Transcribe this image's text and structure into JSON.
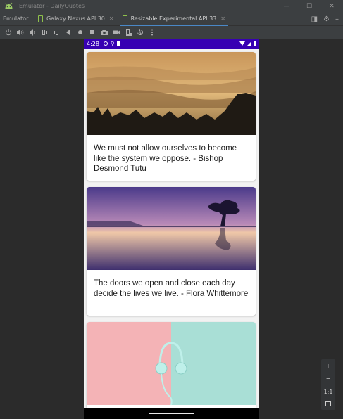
{
  "window": {
    "title": "Emulator - DailyQuotes",
    "minimize_icon": "minimize-icon",
    "maximize_icon": "maximize-icon",
    "close_icon": "close-icon"
  },
  "tabs": {
    "label": "Emulator:",
    "items": [
      {
        "label": "Galaxy Nexus API 30",
        "active": false
      },
      {
        "label": "Resizable Experimental API 33",
        "active": true
      }
    ]
  },
  "toolbar": {
    "icons": [
      "power-icon",
      "volume-up-icon",
      "volume-down-icon",
      "rotate-left-icon",
      "rotate-right-icon",
      "back-icon",
      "home-icon",
      "overview-icon",
      "screenshot-icon",
      "record-icon",
      "fold-icon",
      "snapshot-icon",
      "more-icon"
    ]
  },
  "device": {
    "status": {
      "time": "4:28"
    },
    "cards": [
      {
        "quote": "We must not allow ourselves to become like the system we oppose.  -  Bishop Desmond Tutu"
      },
      {
        "quote": "The doors we open and close each day decide the lives we live.  -  Flora Whittemore"
      },
      {
        "quote": ""
      }
    ]
  },
  "zoom": {
    "zoom_in": "+",
    "zoom_out": "−",
    "actual_size": "1:1"
  },
  "colors": {
    "accent": "#4a88c7",
    "status_bar": "#3700b3",
    "ide_bg": "#2b2b2b"
  }
}
